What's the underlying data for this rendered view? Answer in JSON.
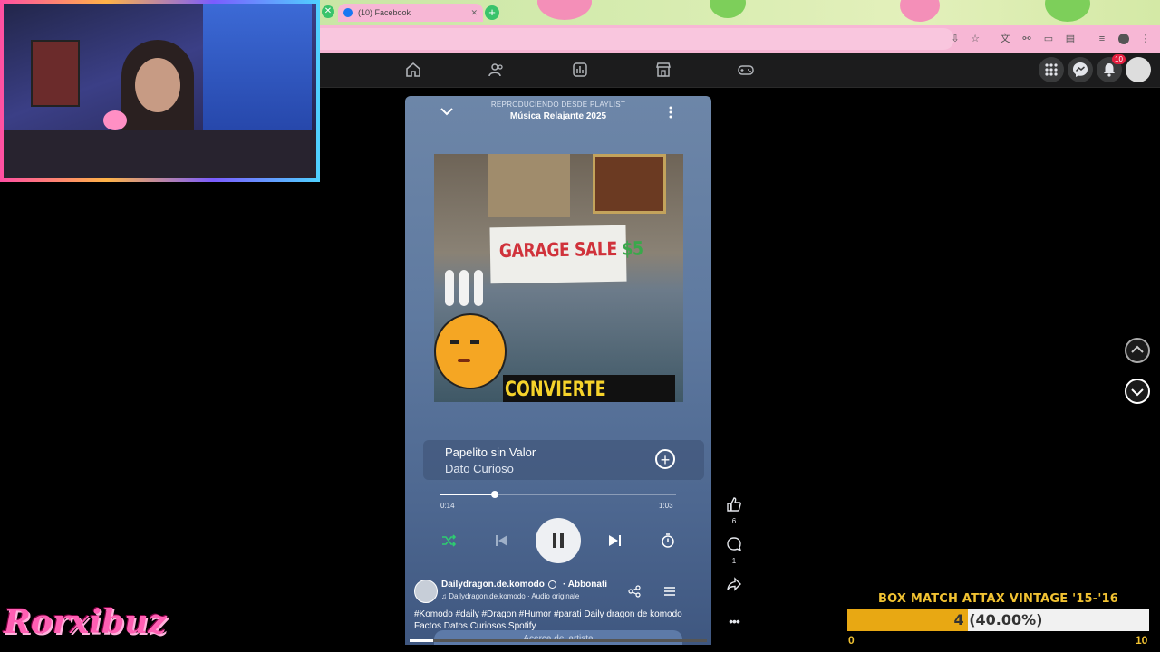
{
  "browser": {
    "tab_title": "(10) Facebook",
    "accent": "#f7b7d5"
  },
  "facebook_nav": {
    "items": [
      "home-icon",
      "friends-icon",
      "video-icon",
      "marketplace-icon",
      "gaming-icon"
    ],
    "notification_count": "10"
  },
  "reel": {
    "playing_from": "REPRODUCIENDO DESDE PLAYLIST",
    "playlist_name": "Música Relajante 2025",
    "cover_sign": "GARAGE SALE",
    "cover_price": "$5",
    "cover_caption": "CONVIERTE",
    "track_title": "Papelito sin Valor",
    "track_artist": "Dato Curioso",
    "progress_fraction": 0.23,
    "time_current": "0:14",
    "time_total": "1:03",
    "author": "Dailydragon.de.komodo",
    "follow": "· Abbonati",
    "audio_line": "Dailydragon.de.komodo · Audio originale",
    "description": "#Komodo #daily #Dragon  #Humor #parati Daily dragon de komodo Factos Datos Curiosos Spotify",
    "artist_button": "Acerca del artista"
  },
  "side_actions": {
    "like_count": "6",
    "comment_count": "1"
  },
  "overlay": {
    "streamer_name": "Rorxibuz",
    "box_match": {
      "title": "BOX MATCH ATTAX VINTAGE '15-'16",
      "label": "4 (40.00%)",
      "fraction": 0.4,
      "min": "0",
      "max": "10"
    }
  }
}
